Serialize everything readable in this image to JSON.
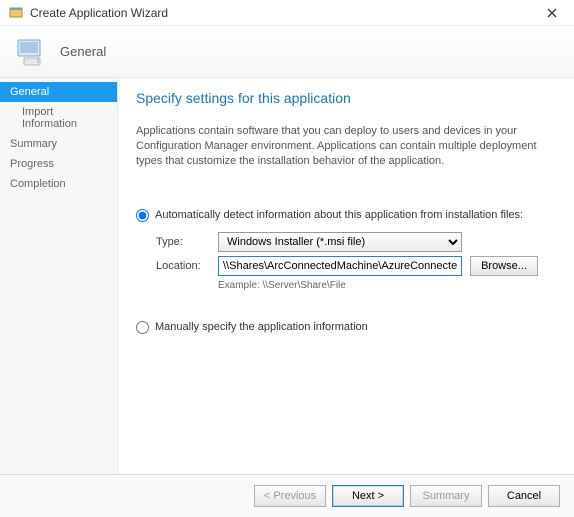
{
  "window": {
    "title": "Create Application Wizard"
  },
  "header": {
    "title": "General"
  },
  "sidebar": {
    "items": [
      {
        "label": "General"
      },
      {
        "label": "Import Information"
      },
      {
        "label": "Summary"
      },
      {
        "label": "Progress"
      },
      {
        "label": "Completion"
      }
    ]
  },
  "page": {
    "title": "Specify settings for this application",
    "desc": "Applications contain software that you can deploy to users and devices in your Configuration Manager environment. Applications can contain multiple deployment types that customize the installation behavior of the application.",
    "radio_auto": "Automatically detect information about this application from installation files:",
    "type_label": "Type:",
    "type_value": "Windows Installer (*.msi file)",
    "location_label": "Location:",
    "location_value": "\\\\Shares\\ArcConnectedMachine\\AzureConnectedMachineAgent.msi",
    "example": "Example: \\\\Server\\Share\\File",
    "browse": "Browse...",
    "radio_manual": "Manually specify the application information"
  },
  "footer": {
    "previous": "< Previous",
    "next": "Next >",
    "summary": "Summary",
    "cancel": "Cancel"
  }
}
